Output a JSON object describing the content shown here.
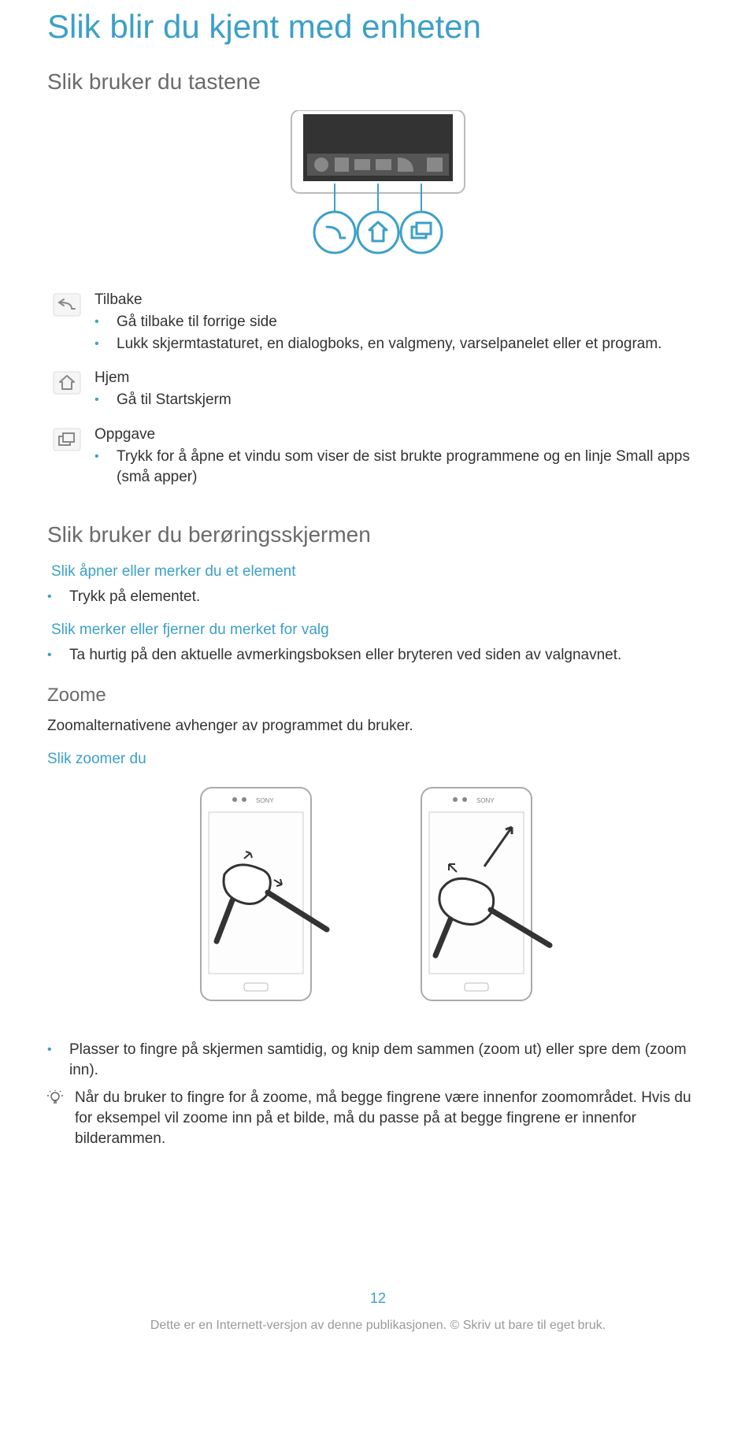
{
  "page_title": "Slik blir du kjent med enheten",
  "section1": {
    "title": "Slik bruker du tastene",
    "items": [
      {
        "name": "Tilbake",
        "bullets": [
          "Gå tilbake til forrige side",
          "Lukk skjermtastaturet, en dialogboks, en valgmeny, varselpanelet eller et program."
        ]
      },
      {
        "name": "Hjem",
        "bullets": [
          "Gå til Startskjerm"
        ]
      },
      {
        "name": "Oppgave",
        "bullets": [
          "Trykk for å åpne et vindu som viser de sist brukte programmene og en linje Small apps (små apper)"
        ]
      }
    ]
  },
  "section2": {
    "title": "Slik bruker du berøringsskjermen",
    "sub1": {
      "heading": "Slik åpner eller merker du et element",
      "bullet": "Trykk på elementet."
    },
    "sub2": {
      "heading": "Slik merker eller fjerner du merket for valg",
      "bullet": "Ta hurtig på den aktuelle avmerkingsboksen eller bryteren ved siden av valgnavnet."
    },
    "zoom": {
      "title": "Zoome",
      "text": "Zoomalternativene avhenger av programmet du bruker.",
      "heading": "Slik zoomer du",
      "bullet": "Plasser to fingre på skjermen samtidig, og knip dem sammen (zoom ut) eller spre dem (zoom inn).",
      "tip": "Når du bruker to fingre for å zoome, må begge fingrene være innenfor zoomområdet. Hvis du for eksempel vil zoome inn på et bilde, må du passe på at begge fingrene er innenfor bilderammen."
    }
  },
  "page_number": "12",
  "footer": "Dette er en Internett-versjon av denne publikasjonen. © Skriv ut bare til eget bruk."
}
